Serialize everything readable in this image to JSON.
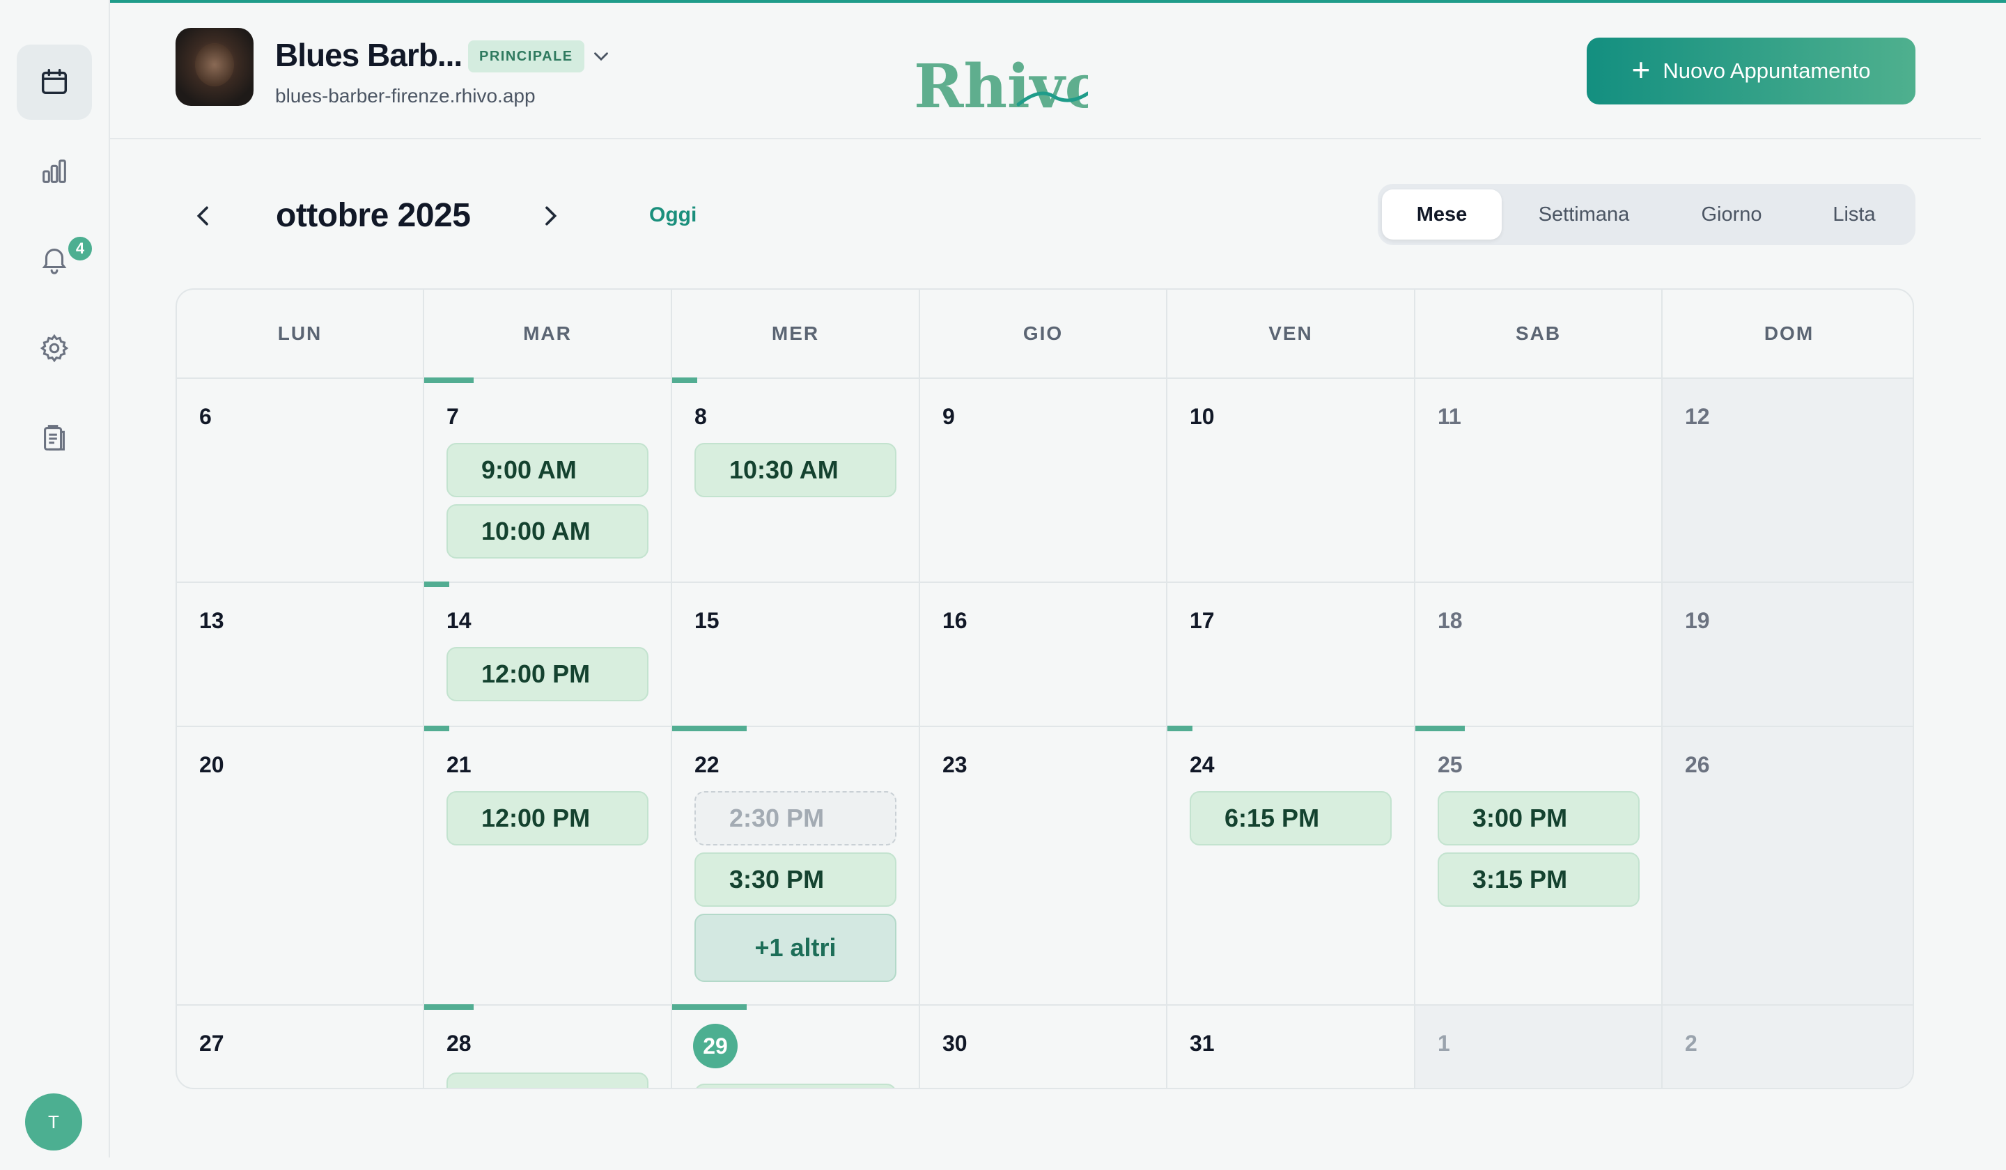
{
  "sidebar": {
    "items": [
      {
        "icon": "calendar-icon",
        "active": true
      },
      {
        "icon": "bar-chart-icon",
        "active": false
      },
      {
        "icon": "bell-icon",
        "active": false,
        "badge": "4"
      },
      {
        "icon": "gear-icon",
        "active": false
      },
      {
        "icon": "clipboard-icon",
        "active": false
      }
    ],
    "user_initial": "T"
  },
  "header": {
    "shop_name": "Blues Barb...",
    "shop_badge": "PRINCIPALE",
    "shop_url": "blues-barber-firenze.rhivo.app",
    "logo": "Rhivo",
    "new_appointment_label": "Nuovo Appuntamento",
    "accent": "#1f9c8a"
  },
  "calendar_nav": {
    "month_label": "ottobre 2025",
    "today_label": "Oggi",
    "views": [
      "Mese",
      "Settimana",
      "Giorno",
      "Lista"
    ],
    "active_view": "Mese"
  },
  "calendar": {
    "weekdays": [
      "LUN",
      "MAR",
      "MER",
      "GIO",
      "VEN",
      "SAB",
      "DOM"
    ],
    "weeks": [
      {
        "days": [
          {
            "num": "6",
            "appts": []
          },
          {
            "num": "7",
            "appts": [
              "9:00 AM",
              "10:00 AM"
            ]
          },
          {
            "num": "8",
            "appts": [
              "10:30 AM"
            ]
          },
          {
            "num": "9",
            "appts": []
          },
          {
            "num": "10",
            "appts": []
          },
          {
            "num": "11",
            "appts": []
          },
          {
            "num": "12",
            "appts": []
          }
        ]
      },
      {
        "days": [
          {
            "num": "13",
            "appts": []
          },
          {
            "num": "14",
            "appts": [
              "12:00 PM"
            ]
          },
          {
            "num": "15",
            "appts": []
          },
          {
            "num": "16",
            "appts": []
          },
          {
            "num": "17",
            "appts": []
          },
          {
            "num": "18",
            "appts": []
          },
          {
            "num": "19",
            "appts": []
          }
        ]
      },
      {
        "days": [
          {
            "num": "20",
            "appts": []
          },
          {
            "num": "21",
            "appts": [
              "12:00 PM"
            ]
          },
          {
            "num": "22",
            "appts": [
              "2:30 PM",
              "3:30 PM"
            ],
            "cancelled": "2:30 PM",
            "more": "+1 altri"
          },
          {
            "num": "23",
            "appts": []
          },
          {
            "num": "24",
            "appts": [
              "6:15 PM"
            ]
          },
          {
            "num": "25",
            "appts": [
              "3:00 PM",
              "3:15 PM"
            ]
          },
          {
            "num": "26",
            "appts": []
          }
        ]
      },
      {
        "days": [
          {
            "num": "27",
            "appts": []
          },
          {
            "num": "28",
            "appts": []
          },
          {
            "num": "29",
            "appts": [],
            "today": true
          },
          {
            "num": "30",
            "appts": []
          },
          {
            "num": "31",
            "appts": []
          },
          {
            "num": "1",
            "appts": [],
            "other_month": true
          },
          {
            "num": "2",
            "appts": [],
            "other_month": true
          }
        ]
      }
    ],
    "busy_fractions": [
      [
        0,
        0.2,
        0.1,
        0,
        0,
        0,
        0
      ],
      [
        0,
        0.1,
        0,
        0,
        0,
        0,
        0
      ],
      [
        0,
        0.1,
        0.3,
        0,
        0.1,
        0.2,
        0
      ],
      [
        0,
        0.2,
        0.3,
        0,
        0,
        0,
        0
      ]
    ]
  }
}
